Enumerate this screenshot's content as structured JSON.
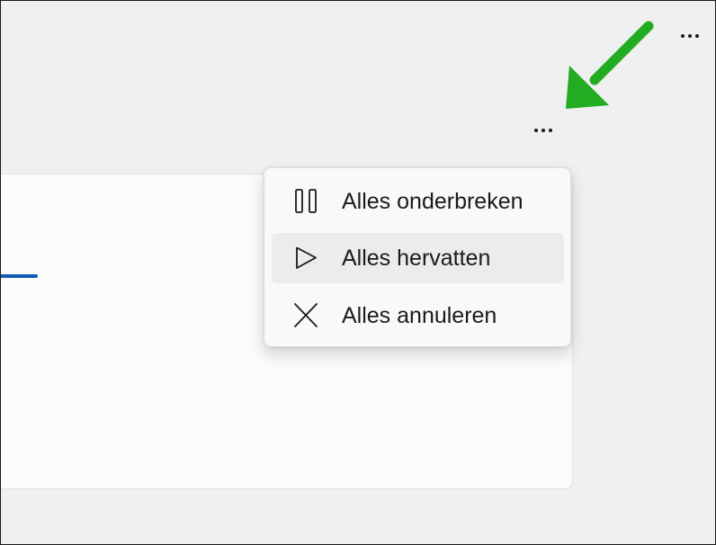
{
  "toolbar": {
    "more_options_icon": "more-horizontal-icon"
  },
  "annotation": {
    "arrow_color": "#22ac22"
  },
  "download_card": {
    "progress_color": "#0f5cb5"
  },
  "context_menu": {
    "items": [
      {
        "label": "Alles onderbreken",
        "icon": "pause-icon"
      },
      {
        "label": "Alles hervatten",
        "icon": "play-icon",
        "hovered": true
      },
      {
        "label": "Alles annuleren",
        "icon": "close-icon"
      }
    ]
  }
}
